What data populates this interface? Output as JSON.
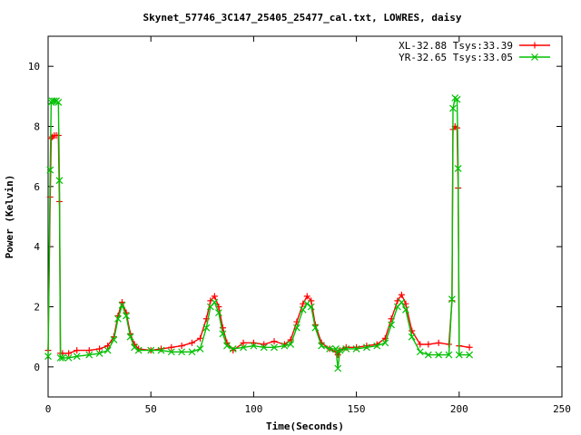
{
  "chart_data": {
    "type": "line",
    "title": "Skynet_57746_3C147_25405_25477_cal.txt, LOWRES, daisy",
    "xlabel": "Time(Seconds)",
    "ylabel": "Power (Kelvin)",
    "xlim": [
      0,
      250
    ],
    "ylim": [
      -1,
      11
    ],
    "xticks": [
      0,
      50,
      100,
      150,
      200,
      250
    ],
    "yticks": [
      0,
      2,
      4,
      6,
      8,
      10
    ],
    "grid": false,
    "legend_position": "top-right",
    "series": [
      {
        "name": "XL-32.88 Tsys:33.39",
        "color": "#ff0000",
        "marker": "plus",
        "x": [
          0,
          1,
          1.5,
          2,
          3,
          4,
          5,
          5.5,
          6,
          7,
          10,
          14,
          20,
          25,
          29,
          32,
          34,
          36,
          38,
          40,
          42,
          44,
          50,
          55,
          60,
          65,
          70,
          74,
          77,
          79,
          81,
          83,
          85,
          87,
          90,
          95,
          100,
          105,
          110,
          115,
          118,
          121,
          124,
          126,
          128,
          130,
          133,
          137,
          140,
          141,
          142,
          145,
          150,
          155,
          160,
          164,
          167,
          170,
          172,
          174,
          177,
          181,
          185,
          190,
          195,
          196.5,
          197,
          198,
          199,
          199.5,
          200,
          205
        ],
        "y": [
          0.55,
          5.65,
          7.6,
          7.65,
          7.7,
          7.7,
          7.7,
          5.5,
          0.45,
          0.45,
          0.45,
          0.55,
          0.55,
          0.6,
          0.7,
          1.0,
          1.7,
          2.15,
          1.8,
          1.1,
          0.75,
          0.6,
          0.55,
          0.6,
          0.65,
          0.7,
          0.8,
          0.95,
          1.6,
          2.2,
          2.35,
          2.0,
          1.3,
          0.8,
          0.55,
          0.8,
          0.8,
          0.75,
          0.85,
          0.75,
          0.9,
          1.5,
          2.1,
          2.35,
          2.2,
          1.4,
          0.8,
          0.6,
          0.5,
          0.4,
          0.55,
          0.65,
          0.65,
          0.7,
          0.75,
          0.95,
          1.6,
          2.2,
          2.4,
          2.1,
          1.2,
          0.75,
          0.75,
          0.8,
          0.75,
          2.2,
          7.9,
          8.0,
          7.95,
          5.95,
          0.7,
          0.65
        ]
      },
      {
        "name": "YR-32.65 Tsys:33.05",
        "color": "#00c000",
        "marker": "cross",
        "x": [
          0,
          1,
          1.5,
          2,
          3,
          4,
          5,
          5.5,
          6,
          7,
          10,
          14,
          20,
          25,
          29,
          32,
          34,
          36,
          38,
          40,
          42,
          44,
          50,
          55,
          60,
          65,
          70,
          74,
          77,
          79,
          81,
          83,
          85,
          87,
          90,
          95,
          100,
          105,
          110,
          115,
          118,
          121,
          124,
          126,
          128,
          130,
          133,
          137,
          140,
          141,
          142,
          145,
          150,
          155,
          160,
          164,
          167,
          170,
          172,
          174,
          177,
          181,
          185,
          190,
          195,
          196.5,
          197,
          198,
          199,
          199.5,
          200,
          205
        ],
        "y": [
          0.35,
          6.55,
          8.8,
          8.85,
          8.85,
          8.85,
          8.8,
          6.2,
          0.3,
          0.3,
          0.3,
          0.35,
          0.4,
          0.45,
          0.55,
          0.9,
          1.6,
          2.05,
          1.7,
          1.0,
          0.65,
          0.55,
          0.55,
          0.55,
          0.5,
          0.5,
          0.5,
          0.6,
          1.3,
          2.0,
          2.15,
          1.8,
          1.1,
          0.7,
          0.6,
          0.65,
          0.7,
          0.65,
          0.65,
          0.7,
          0.75,
          1.3,
          1.9,
          2.1,
          2.0,
          1.3,
          0.7,
          0.6,
          0.6,
          -0.05,
          0.55,
          0.6,
          0.6,
          0.65,
          0.7,
          0.8,
          1.4,
          2.0,
          2.15,
          1.9,
          1.0,
          0.5,
          0.4,
          0.4,
          0.4,
          2.25,
          8.6,
          8.95,
          8.9,
          6.6,
          0.4,
          0.4
        ]
      }
    ]
  }
}
